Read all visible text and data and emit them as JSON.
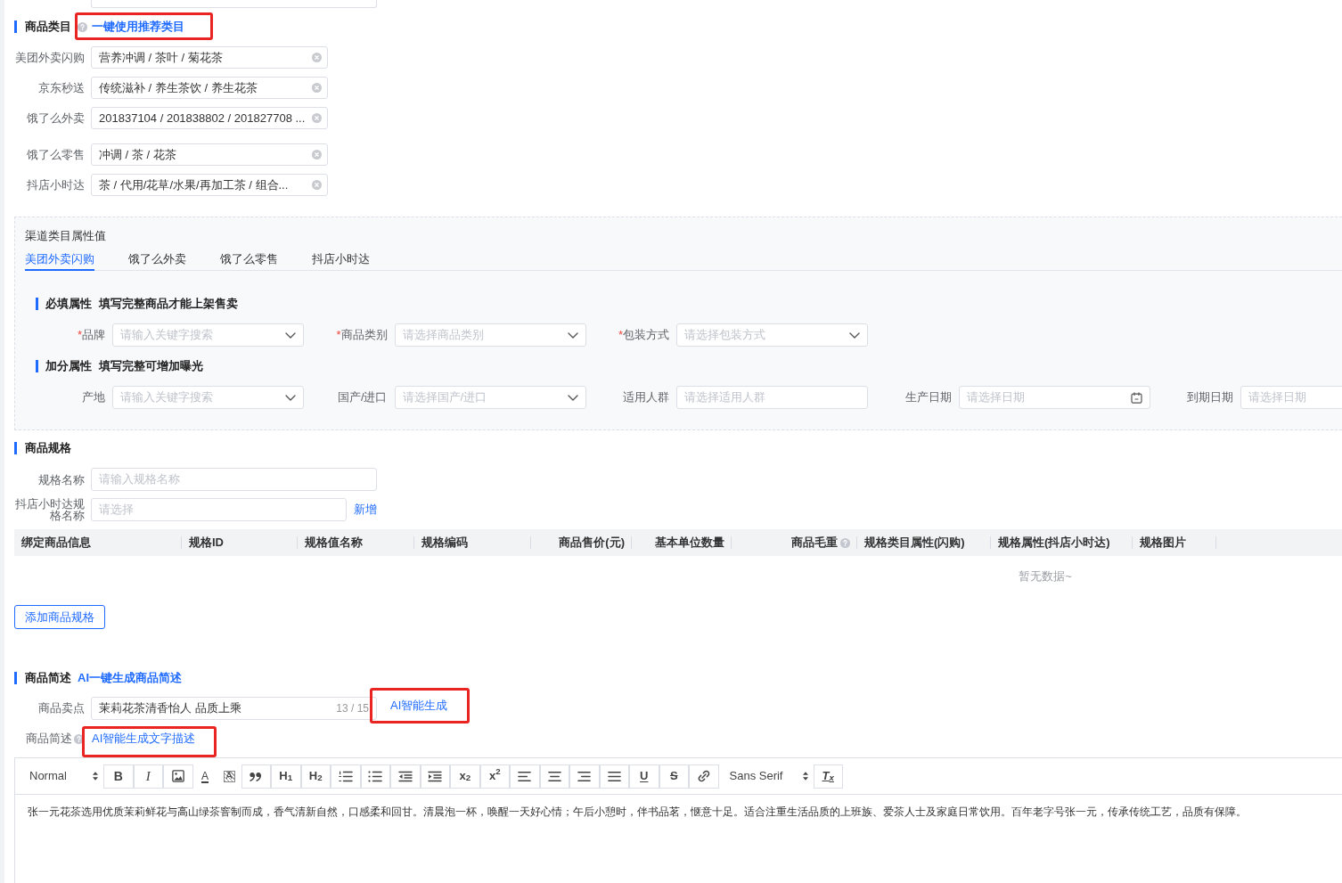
{
  "category": {
    "title": "商品类目",
    "help": true,
    "link": {
      "text": "一键使用推荐类目",
      "highlighted": true
    },
    "fields": [
      {
        "label": "美团外卖闪购",
        "value": "营养冲调 / 茶叶 / 菊花茶"
      },
      {
        "label": "京东秒送",
        "value": "传统滋补 / 养生茶饮 / 养生花茶"
      },
      {
        "label": "饿了么外卖",
        "value": "201837104 / 201838802 / 201827708 ..."
      },
      {
        "label": "饿了么零售",
        "value": "冲调 / 茶 / 花茶"
      },
      {
        "label": "抖店小时达",
        "value": "茶 / 代用/花草/水果/再加工茶 / 组合..."
      }
    ]
  },
  "channel_attributes": {
    "title": "渠道类目属性值",
    "tabs": [
      {
        "label": "美团外卖闪购",
        "selected": true
      },
      {
        "label": "饿了么外卖",
        "selected": false
      },
      {
        "label": "饿了么零售",
        "selected": false
      },
      {
        "label": "抖店小时达",
        "selected": false
      }
    ],
    "groups": [
      {
        "title": "必填属性",
        "hint": "填写完整商品才能上架售卖",
        "fields": [
          {
            "marker": "*",
            "label": "品牌",
            "kind": "select",
            "placeholder": "请输入关键字搜索"
          },
          {
            "marker": "*",
            "label": "商品类别",
            "kind": "select",
            "placeholder": "请选择商品类别"
          },
          {
            "marker": "*",
            "label": "包装方式",
            "kind": "select",
            "placeholder": "请选择包装方式"
          }
        ]
      },
      {
        "title": "加分属性",
        "hint": "填写完整可增加曝光",
        "fields": [
          {
            "label": "产地",
            "kind": "select",
            "placeholder": "请输入关键字搜索"
          },
          {
            "label": "国产/进口",
            "kind": "select",
            "placeholder": "请选择国产/进口"
          },
          {
            "label": "适用人群",
            "kind": "input",
            "placeholder": "请选择适用人群"
          },
          {
            "label": "生产日期",
            "kind": "date",
            "placeholder": "请选择日期"
          },
          {
            "label": "到期日期",
            "kind": "input",
            "placeholder": "请选择日期"
          }
        ]
      }
    ]
  },
  "spec": {
    "title": "商品规格",
    "fields": [
      {
        "label": "规格名称",
        "placeholder": "请输入规格名称"
      },
      {
        "label": "抖店小时达规格名称",
        "placeholder": "请选择",
        "action": "新增"
      }
    ],
    "table": {
      "columns": [
        {
          "label": "绑定商品信息"
        },
        {
          "label": "规格ID"
        },
        {
          "label": "规格值名称"
        },
        {
          "label": "规格编码"
        },
        {
          "label": "商品售价(元)"
        },
        {
          "label": "基本单位数量"
        },
        {
          "label": "商品毛重",
          "help": true
        },
        {
          "label": "规格类目属性(闪购)"
        },
        {
          "label": "规格属性(抖店小时达)"
        },
        {
          "label": "规格图片"
        }
      ],
      "empty_text": "暂无数据~"
    },
    "add_button": "添加商品规格"
  },
  "description": {
    "title": "商品简述",
    "link": {
      "text": "AI一键生成商品简述"
    },
    "selling_point": {
      "label": "商品卖点",
      "value": "茉莉花茶清香怡人 品质上乘",
      "counter": "13 / 15",
      "button": {
        "text": "AI智能生成",
        "highlighted": true
      }
    },
    "summary": {
      "label": "商品简述",
      "help": true,
      "link": {
        "text": "AI智能生成文字描述",
        "highlighted": true
      }
    },
    "editor": {
      "toolbar": [
        {
          "kind": "format",
          "value": "Normal"
        },
        {
          "kind": "bold",
          "label": "B"
        },
        {
          "kind": "italic",
          "label": "I"
        },
        {
          "kind": "image"
        },
        {
          "kind": "color",
          "label": "A"
        },
        {
          "kind": "background",
          "label": "A"
        },
        {
          "kind": "quote"
        },
        {
          "kind": "heading",
          "label": "H$_{1}$"
        },
        {
          "kind": "heading",
          "label": "H$_{2}$"
        },
        {
          "kind": "ordered"
        },
        {
          "kind": "bullet"
        },
        {
          "kind": "outdent"
        },
        {
          "kind": "indent"
        },
        {
          "kind": "script",
          "label": "x$_{2}$"
        },
        {
          "kind": "script",
          "label": "x$^{2}$"
        },
        {
          "kind": "left"
        },
        {
          "kind": "center"
        },
        {
          "kind": "right"
        },
        {
          "kind": "justify"
        },
        {
          "kind": "underline",
          "label": "U"
        },
        {
          "kind": "strike",
          "label": "S"
        },
        {
          "kind": "link"
        },
        {
          "kind": "font",
          "value": "Sans Serif"
        },
        {
          "kind": "clean",
          "label": "T$_{x}$"
        }
      ],
      "content": "张一元花茶选用优质茉莉鲜花与高山绿茶窨制而成，香气清新自然，口感柔和回甘。清晨泡一杯，唤醒一天好心情；午后小憩时，伴书品茗，惬意十足。适合注重生活品质的上班族、爱茶人士及家庭日常饮用。百年老字号张一元，传承传统工艺，品质有保障。"
    }
  }
}
